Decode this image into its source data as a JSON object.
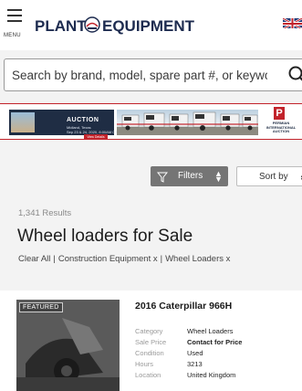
{
  "header": {
    "menu_label": "MENU",
    "logo_text_left": "PLANT",
    "logo_text_right": "EQUIPMENT",
    "region_flag": "uk-flag-icon"
  },
  "search": {
    "placeholder": "Search by brand, model, spare part #, or keyword",
    "icon": "search-icon"
  },
  "ad": {
    "title": "AUCTION",
    "subtitle": "Midland, Texas\nSep 23 & 24, 2020, 8:00AM CT",
    "button": "View Details",
    "brand_letter": "P",
    "brand_name": "PERMIAN\nINTERNATIONAL\nAUCTION"
  },
  "toolbar": {
    "filters_label": "Filters",
    "sort_label": "Sort by"
  },
  "results": {
    "count": "1,341 Results",
    "title": "Wheel loaders for Sale",
    "clear_all": "Clear All",
    "filters": [
      "Construction Equipment x",
      "Wheel Loaders x"
    ]
  },
  "listing": {
    "badge": "FEATURED",
    "title": "2016 Caterpillar 966H",
    "specs": [
      {
        "key": "Category",
        "value": "Wheel Loaders"
      },
      {
        "key": "Sale Price",
        "value": "Contact for Price"
      },
      {
        "key": "Condition",
        "value": "Used"
      },
      {
        "key": "Hours",
        "value": "3213"
      },
      {
        "key": "Location",
        "value": "United Kingdom"
      }
    ]
  },
  "colors": {
    "accent": "#c2232b",
    "filter_button": "#757575",
    "page_bg": "#f3f3f3"
  }
}
